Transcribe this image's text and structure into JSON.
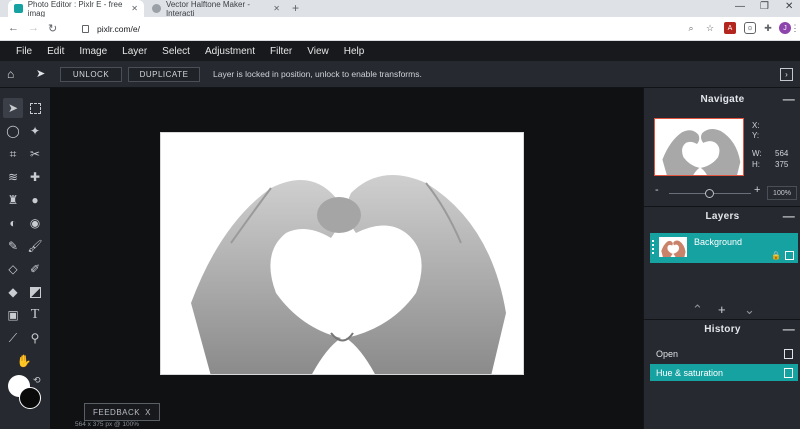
{
  "browser": {
    "tabs": [
      {
        "title": "Photo Editor : Pixlr E - free imag",
        "active": true
      },
      {
        "title": "Vector Halftone Maker - Interacti",
        "active": false
      }
    ],
    "new_tab": "+",
    "url": "pixlr.com/e/",
    "profile_initial": "J"
  },
  "menu": [
    "File",
    "Edit",
    "Image",
    "Layer",
    "Select",
    "Adjustment",
    "Filter",
    "View",
    "Help"
  ],
  "toolbar": {
    "unlock_label": "UNLOCK",
    "duplicate_label": "DUPLICATE",
    "message": "Layer is locked in position, unlock to enable transforms."
  },
  "tools": [
    "arrange-tool",
    "marquee-tool",
    "lasso-tool",
    "wand-tool",
    "crop-tool",
    "cutout-tool",
    "liquify-tool",
    "heal-tool",
    "clone-tool",
    "blur-tool",
    "sponge-tool",
    "dodge-tool",
    "pencil-tool",
    "brush-tool",
    "eraser-tool",
    "color-replace-tool",
    "fill-tool",
    "gradient-tool",
    "shape-tool",
    "text-tool",
    "eyedropper-tool",
    "zoom-tool",
    "hand-tool"
  ],
  "canvas": {
    "feedback_label": "FEEDBACK",
    "feedback_close": "X",
    "status": "564 x 375 px @ 100%"
  },
  "navigate": {
    "title": "Navigate",
    "x_label": "X:",
    "y_label": "Y:",
    "w_label": "W:",
    "w_value": "564",
    "h_label": "H:",
    "h_value": "375",
    "zoom_minus": "-",
    "zoom_plus": "+",
    "zoom_value": "100%",
    "zoom_level": 0.5
  },
  "layers": {
    "title": "Layers",
    "items": [
      {
        "name": "Background",
        "locked": true,
        "visible": true
      }
    ]
  },
  "history": {
    "title": "History",
    "items": [
      {
        "label": "Open"
      },
      {
        "label": "Hue & saturation",
        "active": true
      }
    ]
  },
  "colors": {
    "accent": "#17a2a2",
    "menu_bg": "#17191c",
    "panel_bg": "#262a30",
    "workspace_bg": "#0f1113"
  }
}
